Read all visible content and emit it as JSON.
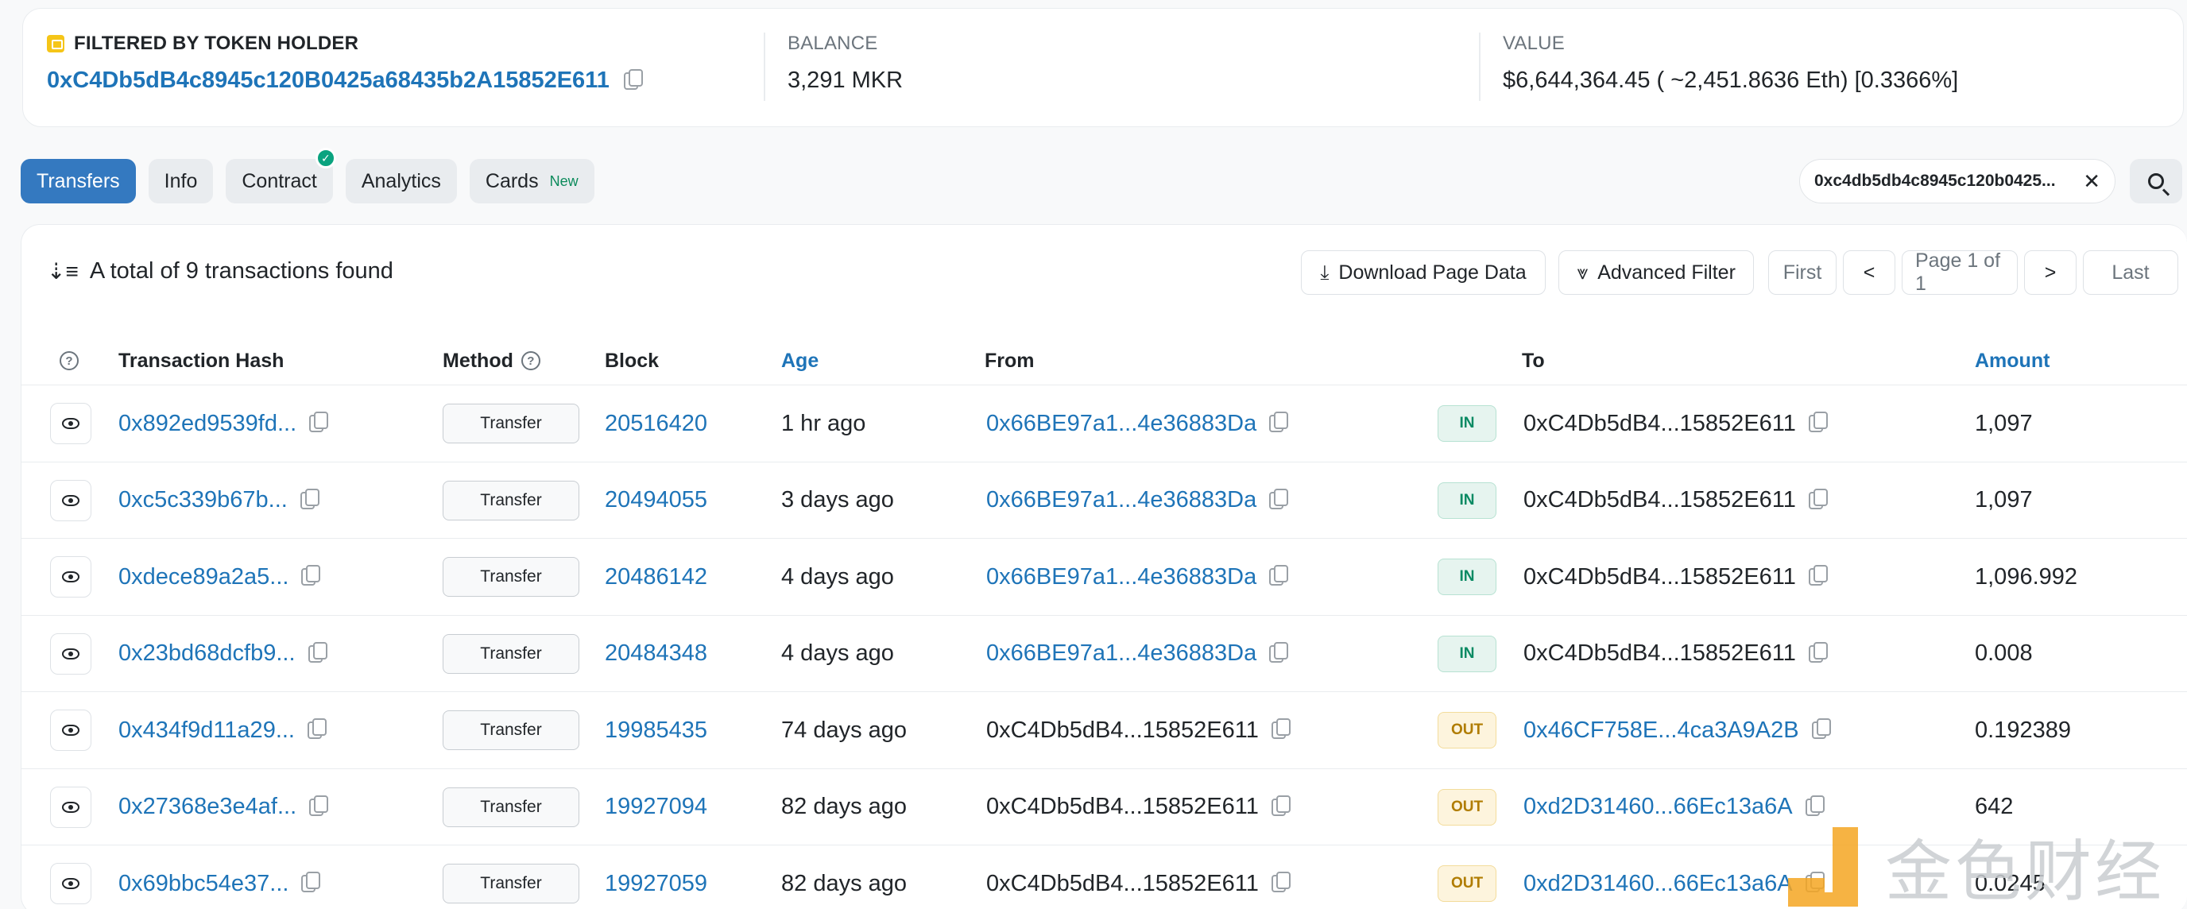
{
  "header": {
    "filter_label": "FILTERED BY TOKEN HOLDER",
    "holder_address": "0xC4Db5dB4c8945c120B0425a68435b2A15852E611",
    "balance_label": "BALANCE",
    "balance_value": "3,291 MKR",
    "value_label": "VALUE",
    "value_value": "$6,644,364.45 ( ~2,451.8636 Eth) [0.3366%]"
  },
  "tabs": [
    {
      "label": "Transfers",
      "active": true
    },
    {
      "label": "Info"
    },
    {
      "label": "Contract",
      "verified": true
    },
    {
      "label": "Analytics"
    },
    {
      "label": "Cards",
      "badge": "New"
    }
  ],
  "filter": {
    "address": "0xc4db5db4c8945c120b0425..."
  },
  "summary": {
    "text": "A total of 9 transactions found"
  },
  "toolbar": {
    "download": "Download Page Data",
    "advanced_filter": "Advanced Filter",
    "first": "First",
    "prev": "<",
    "page": "Page 1 of 1",
    "next": ">",
    "last": "Last"
  },
  "columns": {
    "hash": "Transaction Hash",
    "method": "Method",
    "block": "Block",
    "age": "Age",
    "from": "From",
    "to": "To",
    "amount": "Amount"
  },
  "rows": [
    {
      "hash": "0x892ed9539fd...",
      "method": "Transfer",
      "block": "20516420",
      "age": "1 hr ago",
      "from": "0x66BE97a1...4e36883Da",
      "dir": "IN",
      "to": "0xC4Db5dB4...15852E611",
      "amount": "1,097"
    },
    {
      "hash": "0xc5c339b67b...",
      "method": "Transfer",
      "block": "20494055",
      "age": "3 days ago",
      "from": "0x66BE97a1...4e36883Da",
      "dir": "IN",
      "to": "0xC4Db5dB4...15852E611",
      "amount": "1,097"
    },
    {
      "hash": "0xdece89a2a5...",
      "method": "Transfer",
      "block": "20486142",
      "age": "4 days ago",
      "from": "0x66BE97a1...4e36883Da",
      "dir": "IN",
      "to": "0xC4Db5dB4...15852E611",
      "amount": "1,096.992"
    },
    {
      "hash": "0x23bd68dcfb9...",
      "method": "Transfer",
      "block": "20484348",
      "age": "4 days ago",
      "from": "0x66BE97a1...4e36883Da",
      "dir": "IN",
      "to": "0xC4Db5dB4...15852E611",
      "amount": "0.008"
    },
    {
      "hash": "0x434f9d11a29...",
      "method": "Transfer",
      "block": "19985435",
      "age": "74 days ago",
      "from": "0xC4Db5dB4...15852E611",
      "dir": "OUT",
      "to": "0x46CF758E...4ca3A9A2B",
      "amount": "0.192389"
    },
    {
      "hash": "0x27368e3e4af...",
      "method": "Transfer",
      "block": "19927094",
      "age": "82 days ago",
      "from": "0xC4Db5dB4...15852E611",
      "dir": "OUT",
      "to": "0xd2D31460...66Ec13a6A",
      "amount": "642"
    },
    {
      "hash": "0x69bbc54e37...",
      "method": "Transfer",
      "block": "19927059",
      "age": "82 days ago",
      "from": "0xC4Db5dB4...15852E611",
      "dir": "OUT",
      "to": "0xd2D31460...66Ec13a6A",
      "amount": "0.0245"
    }
  ],
  "watermark": {
    "text": "金色财经"
  },
  "colors": {
    "link": "#1e74b8",
    "active_tab": "#3479c0",
    "in": "#0a8a63",
    "out": "#b07c00"
  }
}
